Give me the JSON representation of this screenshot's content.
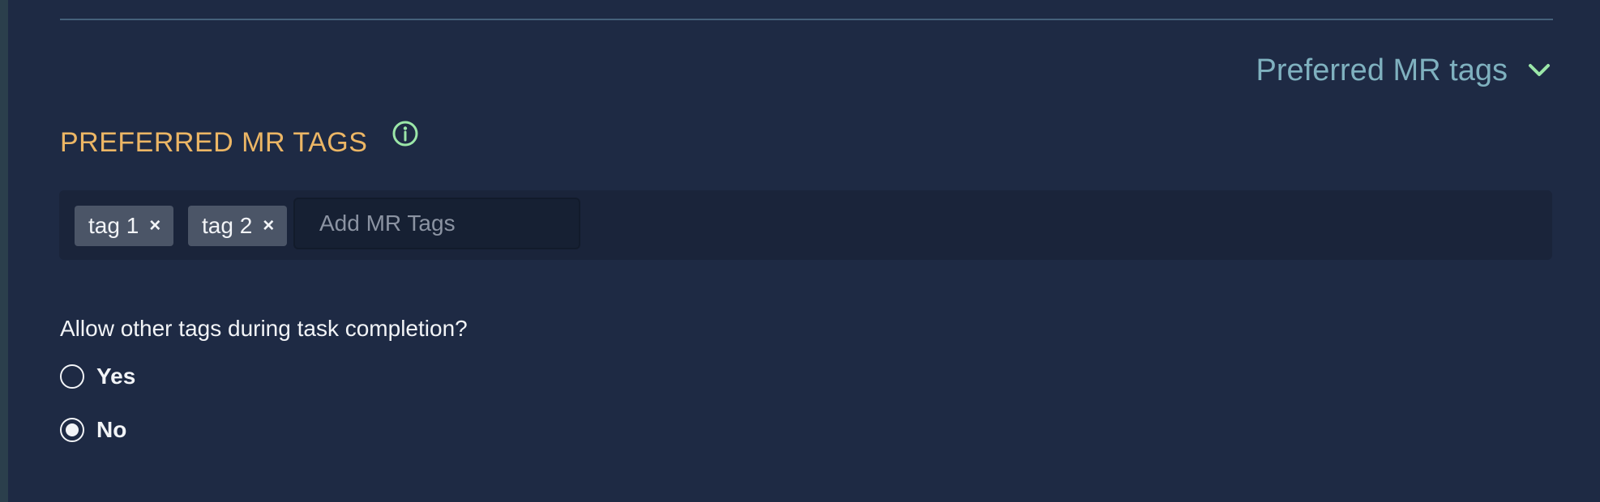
{
  "section_toggle": {
    "label": "Preferred MR tags",
    "icon": "chevron-down-icon",
    "expanded": true
  },
  "section": {
    "heading": "PREFERRED MR TAGS",
    "info_icon": "info-icon"
  },
  "tags": {
    "items": [
      {
        "label": "tag 1",
        "remove": "×"
      },
      {
        "label": "tag 2",
        "remove": "×"
      }
    ],
    "input_placeholder": "Add MR Tags",
    "input_value": ""
  },
  "allow_other_tags": {
    "question": "Allow other tags during task completion?",
    "options": [
      {
        "label": "Yes",
        "selected": false
      },
      {
        "label": "No",
        "selected": true
      }
    ]
  },
  "colors": {
    "background": "#1e2a44",
    "heading_accent": "#ecb665",
    "toggle_text": "#7fb1bf",
    "icon_green": "#9be6a8",
    "chip_bg": "#4b5567"
  }
}
